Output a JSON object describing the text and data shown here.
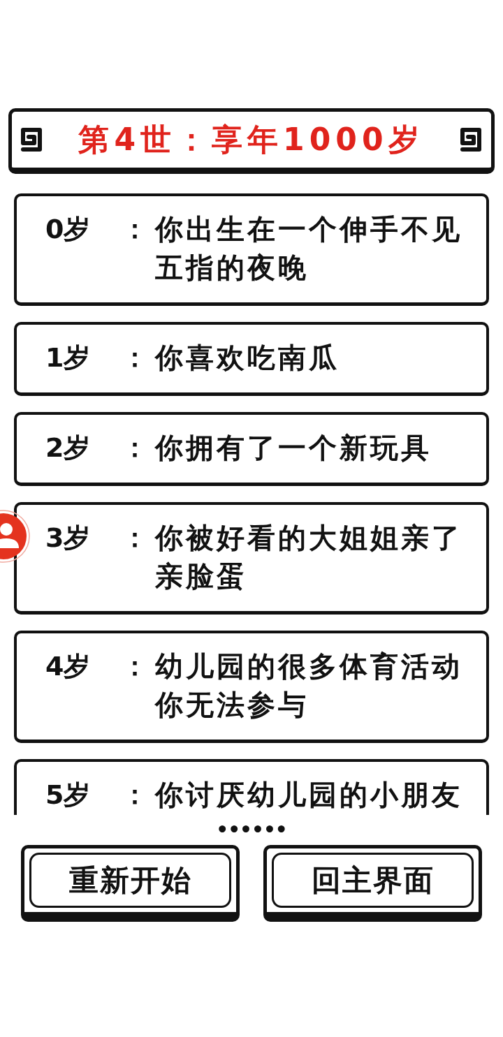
{
  "header": {
    "title": "第4世：享年1000岁"
  },
  "events": [
    {
      "age": "0岁",
      "separator": "：",
      "text": "你出生在一个伸手不见五指的夜晚"
    },
    {
      "age": "1岁",
      "separator": "：",
      "text": "你喜欢吃南瓜"
    },
    {
      "age": "2岁",
      "separator": "：",
      "text": "你拥有了一个新玩具"
    },
    {
      "age": "3岁",
      "separator": "：",
      "text": "你被好看的大姐姐亲了亲脸蛋"
    },
    {
      "age": "4岁",
      "separator": "：",
      "text": "幼儿园的很多体育活动你无法参与"
    },
    {
      "age": "5岁",
      "separator": "：",
      "text": "你讨厌幼儿园的小朋友"
    }
  ],
  "more_indicator": "••••••",
  "buttons": [
    {
      "label": "重新开始"
    },
    {
      "label": "回主界面"
    }
  ]
}
